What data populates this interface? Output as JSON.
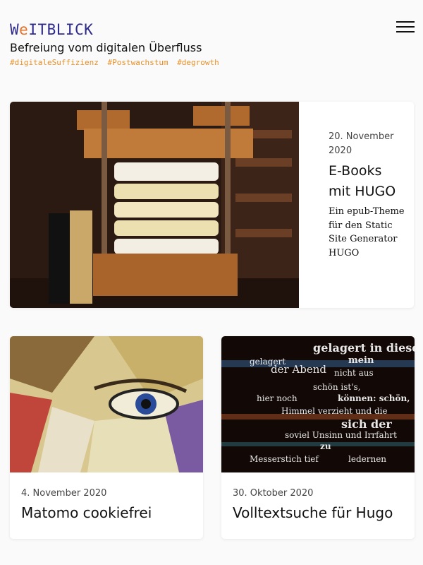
{
  "header": {
    "logo_first": "W",
    "logo_accent": "e",
    "logo_rest": "ITBLICK",
    "tagline": "Befreiung vom digitalen Überfluss",
    "hashtags": [
      "#digitaleSuffizienz",
      "#Postwachstum",
      "#degrowth"
    ],
    "menu_icon": "hamburger-menu-icon"
  },
  "colors": {
    "logo": "#2d2a8c",
    "accent": "#e8712a",
    "hashtags": "#e8902a"
  },
  "featured": {
    "date": "20. November 2020",
    "title": "E-Books mit HUGO",
    "description": "Ein epub-Theme für den Static Site Generator HUGO"
  },
  "posts": [
    {
      "date": "4. November 2020",
      "title": "Matomo cookiefrei"
    },
    {
      "date": "30. Oktober 2020",
      "title": "Volltextsuche für Hugo"
    }
  ],
  "poem_text": {
    "line1": "gelagert in dieses mein",
    "line2": "gelagert",
    "line3": "mein",
    "line4": "der Abend",
    "line5": "nicht aus",
    "line6": "schön ist's,",
    "line7": "hier noch",
    "line8": "können: schön,",
    "line9": "Himmel verzieht",
    "line10": "und die",
    "line11": "sich der",
    "line12": "soviel Unsinn und Irrfahrt",
    "line13": "zu",
    "line14": "Messerstich tief",
    "line15": "ledernen"
  }
}
